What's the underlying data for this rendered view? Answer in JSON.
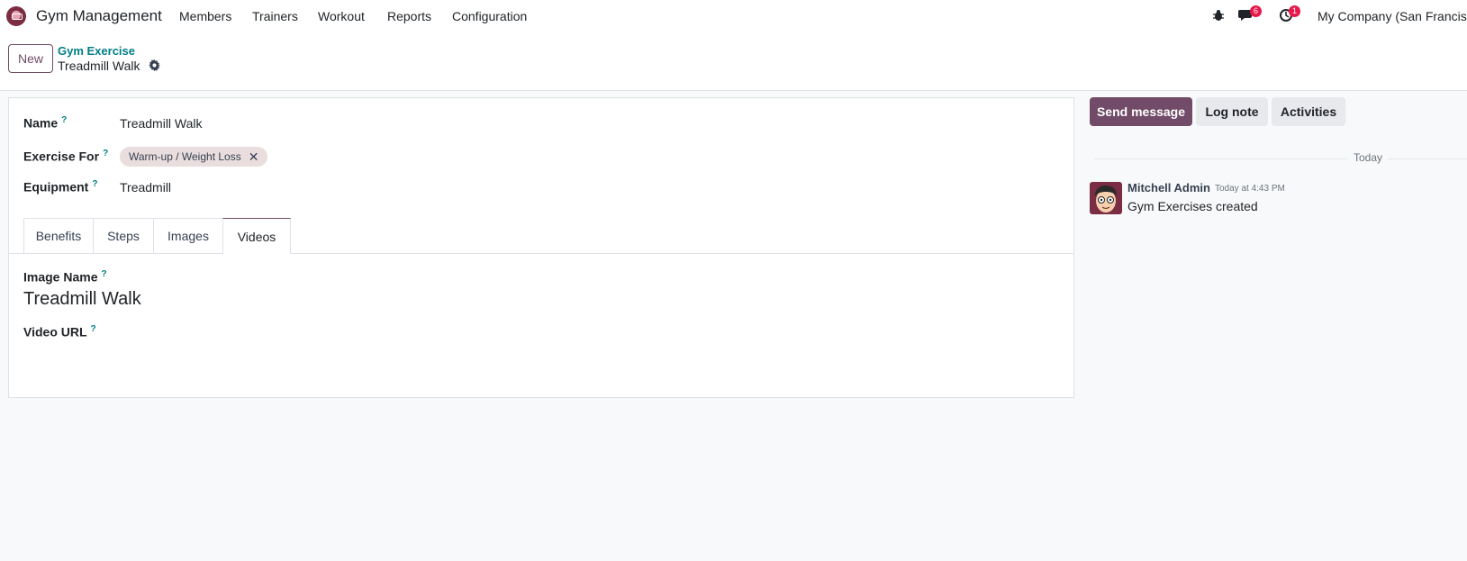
{
  "navbar": {
    "app_name": "Gym Management",
    "menu": [
      "Members",
      "Trainers",
      "Workout",
      "Reports",
      "Configuration"
    ],
    "messages_count": "6",
    "activities_count": "1",
    "company": "My Company (San Francisco)"
  },
  "control_panel": {
    "new_label": "New",
    "breadcrumb": "Gym Exercise",
    "record_title": "Treadmill Walk"
  },
  "form": {
    "name_label": "Name",
    "name_value": "Treadmill Walk",
    "exercise_for_label": "Exercise For",
    "exercise_for_tag": "Warm-up / Weight Loss",
    "equipment_label": "Equipment",
    "equipment_value": "Treadmill",
    "help_mark": "?",
    "tabs": [
      "Benefits",
      "Steps",
      "Images",
      "Videos"
    ],
    "active_tab": "Videos",
    "image_name_label": "Image Name",
    "image_name_value": "Treadmill Walk",
    "video_url_label": "Video URL"
  },
  "chatter": {
    "send_message": "Send message",
    "log_note": "Log note",
    "activities": "Activities",
    "separator": "Today",
    "message": {
      "author": "Mitchell Admin",
      "date": "Today at 4:43 PM",
      "body": "Gym Exercises created"
    }
  },
  "colors": {
    "brand": "#714b67",
    "link": "#017e84",
    "badge": "#e8174a"
  }
}
